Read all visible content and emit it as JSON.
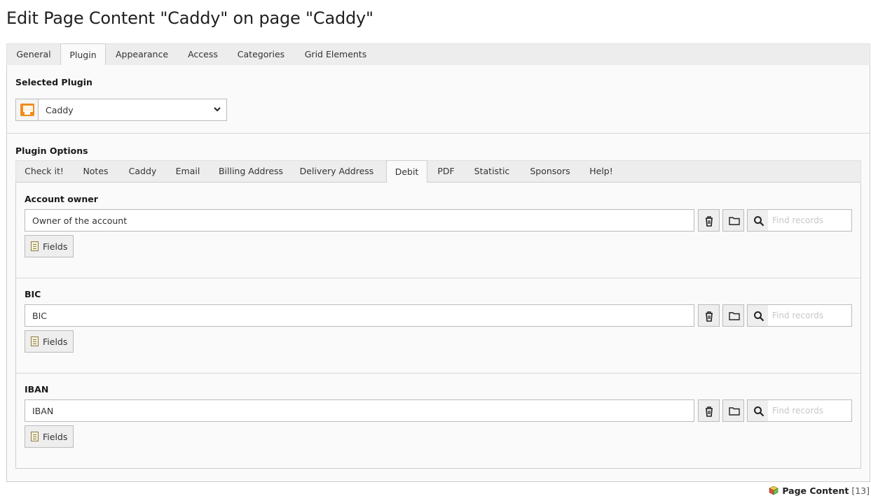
{
  "page_title": "Edit Page Content \"Caddy\" on page \"Caddy\"",
  "main_tabs": [
    {
      "label": "General"
    },
    {
      "label": "Plugin",
      "active": true
    },
    {
      "label": "Appearance"
    },
    {
      "label": "Access"
    },
    {
      "label": "Categories"
    },
    {
      "label": "Grid Elements"
    }
  ],
  "selected_plugin": {
    "label": "Selected Plugin",
    "value": "Caddy",
    "icon": "caddy-plugin-icon"
  },
  "plugin_options": {
    "label": "Plugin Options",
    "tabs": [
      {
        "label": "Check it!"
      },
      {
        "label": "Notes"
      },
      {
        "label": "Caddy"
      },
      {
        "label": "Email"
      },
      {
        "label": "Billing Address"
      },
      {
        "label": "Delivery Address"
      },
      {
        "label": "Debit",
        "active": true
      },
      {
        "label": "PDF"
      },
      {
        "label": "Statistic"
      },
      {
        "label": "Sponsors"
      },
      {
        "label": "Help!"
      }
    ],
    "fields": [
      {
        "label": "Account owner",
        "value": "Owner of the account",
        "find_placeholder": "Find records",
        "fields_button": "Fields"
      },
      {
        "label": "BIC",
        "value": "BIC",
        "find_placeholder": "Find records",
        "fields_button": "Fields"
      },
      {
        "label": "IBAN",
        "value": "IBAN",
        "find_placeholder": "Find records",
        "fields_button": "Fields"
      }
    ]
  },
  "footer": {
    "label": "Page Content",
    "count": "[13]"
  }
}
